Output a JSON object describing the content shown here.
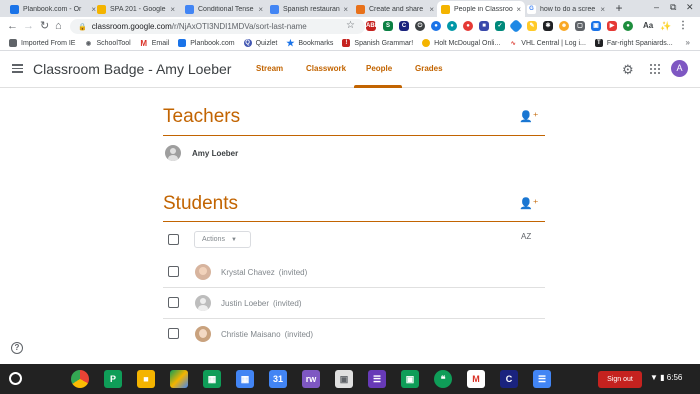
{
  "browser": {
    "tabs": [
      {
        "title": "Planbook.com - Or",
        "favicon": "planbook-icon",
        "color": "#1a73e8",
        "active": false
      },
      {
        "title": "SPA 201 - Google S",
        "favicon": "google-drive-icon",
        "color": "#f4b400",
        "active": false
      },
      {
        "title": "Conditional Tense",
        "favicon": "google-docs-icon",
        "color": "#4285f4",
        "active": false
      },
      {
        "title": "Spanish restaurant",
        "favicon": "google-docs-icon",
        "color": "#4285f4",
        "active": false
      },
      {
        "title": "Create and share",
        "favicon": "shield-icon",
        "color": "#e8711a",
        "active": false
      },
      {
        "title": "People in Classroo",
        "favicon": "classroom-icon",
        "color": "#f4b400",
        "active": true
      },
      {
        "title": "how to do a scree",
        "favicon": "google-icon",
        "color": "#4285f4",
        "active": false
      }
    ],
    "close_glyph": "×",
    "new_tab_glyph": "+",
    "url_host": "classroom.google.com",
    "url_path": "/r/NjAxOTI3NDI1MDVa/sort-last-name",
    "bookmarks": [
      {
        "label": "Imported From IE",
        "icon": "folder-icon",
        "color": "#5f6368"
      },
      {
        "label": "SchoolTool",
        "icon": "schooltool-icon",
        "color": "#5f6368"
      },
      {
        "label": "Email",
        "icon": "gmail-icon",
        "color": "#d93025"
      },
      {
        "label": "Planbook.com",
        "icon": "planbook-icon",
        "color": "#1a73e8"
      },
      {
        "label": "Quizlet",
        "icon": "quizlet-icon",
        "color": "#4257b2"
      },
      {
        "label": "Bookmarks",
        "icon": "star-icon",
        "color": "#1a73e8"
      },
      {
        "label": "Spanish Grammar!",
        "icon": "bookmark-icon",
        "color": "#c5221f"
      },
      {
        "label": "Holt McDougal Onli...",
        "icon": "holt-icon",
        "color": "#f4b400"
      },
      {
        "label": "VHL Central | Log i...",
        "icon": "vhl-icon",
        "color": "#d93025"
      },
      {
        "label": "Far-right Spaniards...",
        "icon": "nyt-icon",
        "color": "#202124"
      }
    ],
    "bookmarks_more": "»"
  },
  "classroom": {
    "class_title": "Classroom Badge - Amy Loeber",
    "nav_tabs": [
      "Stream",
      "Classwork",
      "People",
      "Grades"
    ],
    "active_tab": "People",
    "accent_color": "#c26401",
    "account_initial": "A",
    "teachers_heading": "Teachers",
    "teachers": [
      {
        "name": "Amy Loeber"
      }
    ],
    "students_heading": "Students",
    "actions_label": "Actions",
    "sort_label": "AZ",
    "students": [
      {
        "name": "Krystal Chavez",
        "status": "(invited)"
      },
      {
        "name": "Justin Loeber",
        "status": "(invited)"
      },
      {
        "name": "Christie Maisano",
        "status": "(invited)"
      }
    ],
    "help_label": "?"
  },
  "shelf": {
    "sign_out_label": "Sign out",
    "time": "6:56",
    "calendar_day": "31"
  }
}
